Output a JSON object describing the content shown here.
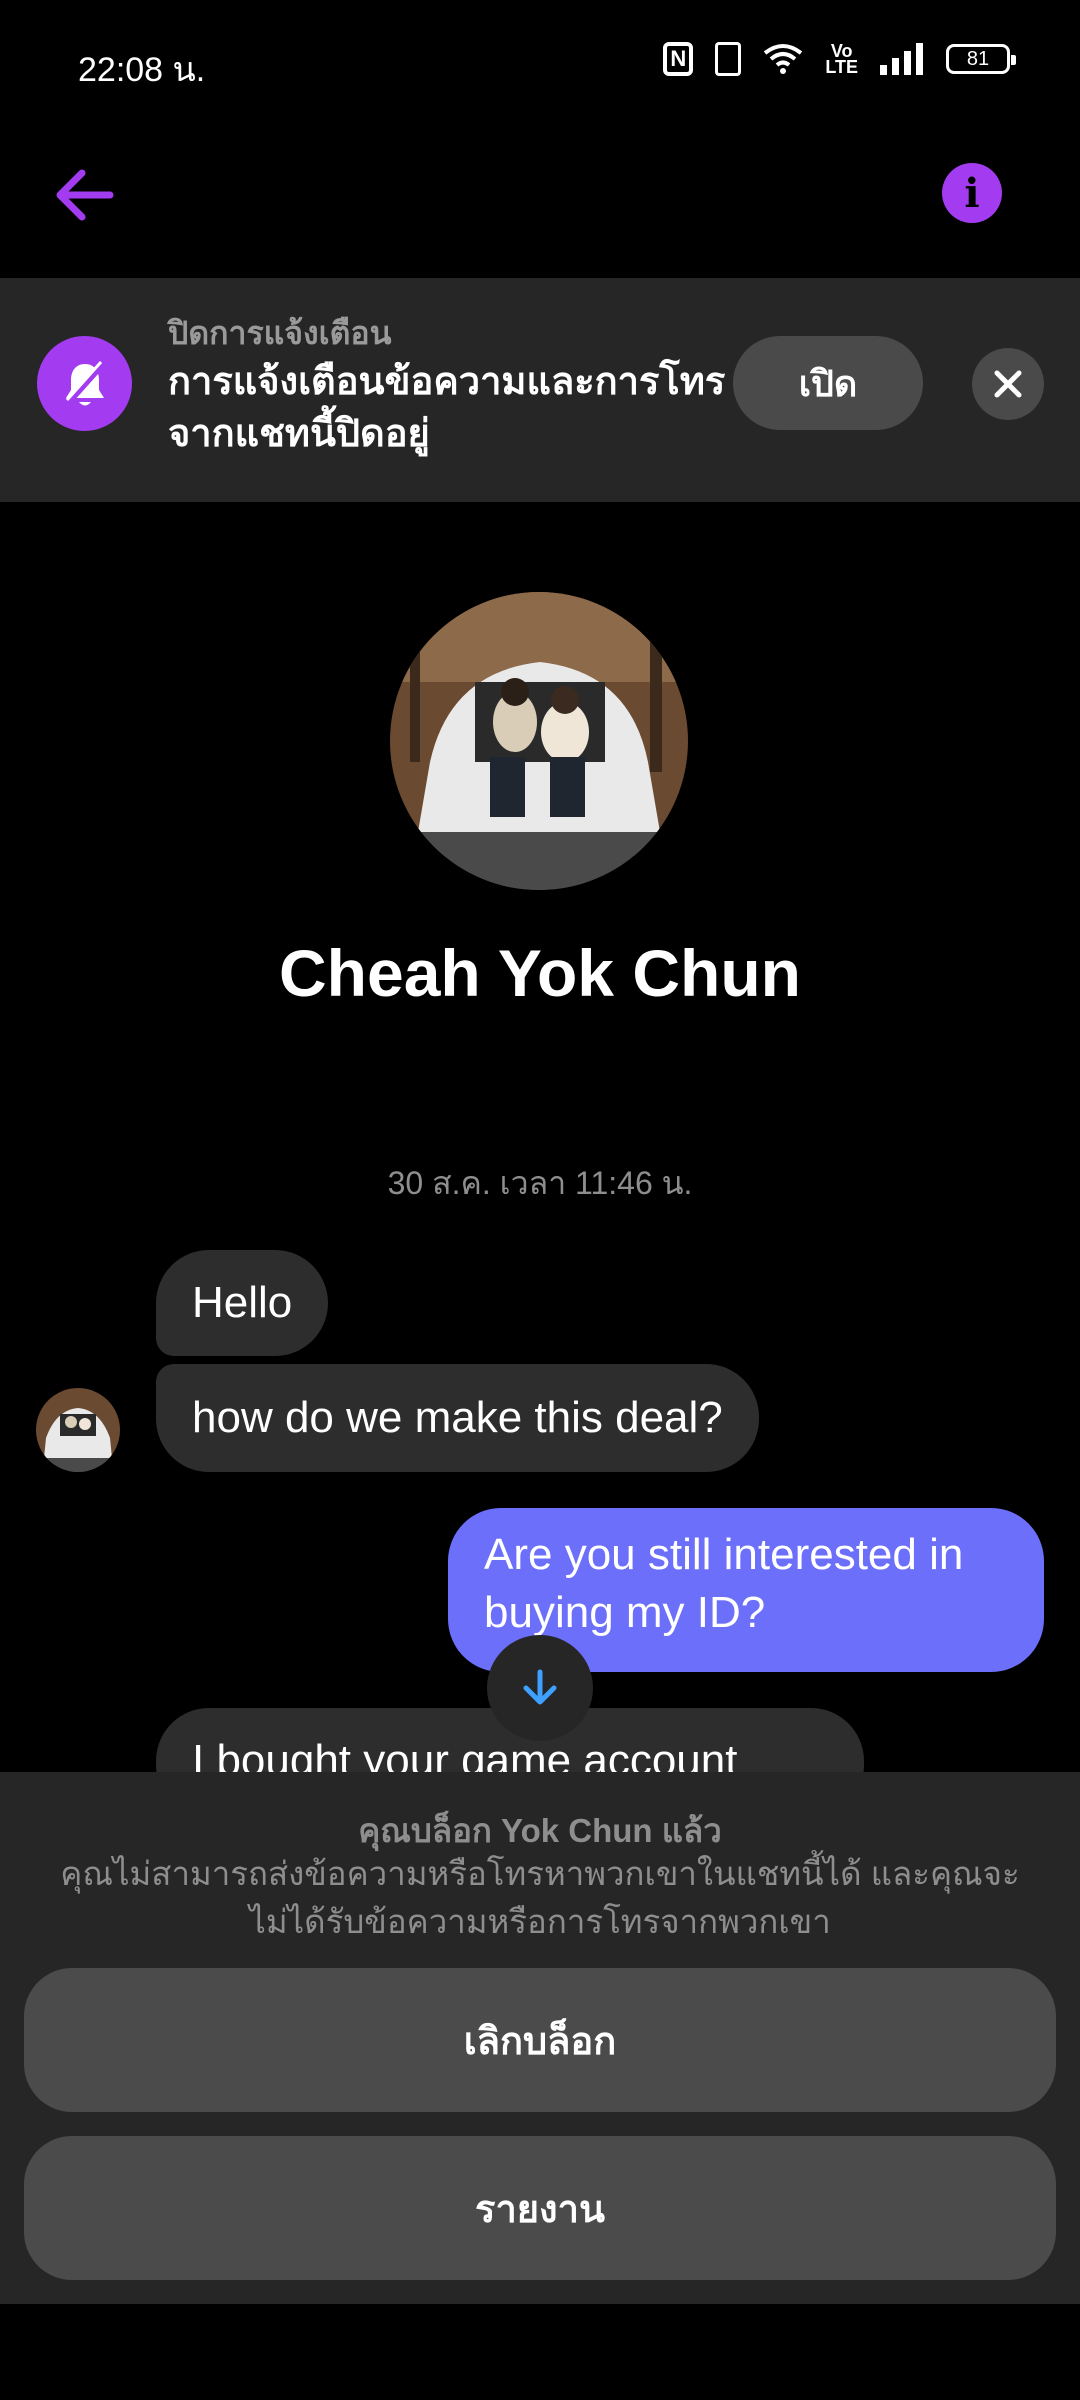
{
  "status_bar": {
    "time": "22:08 น.",
    "nfc": "N",
    "volte": "Vo\nLTE",
    "battery": "81"
  },
  "header": {
    "back_icon": "arrow-left-icon",
    "info_icon": "info-icon",
    "accent_color": "#a33cf0"
  },
  "mute_banner": {
    "icon": "bell-off-icon",
    "title": "ปิดการแจ้งเตือน",
    "message": "การแจ้งเตือนข้อความและการโทรจากแชทนี้ปิดอยู่",
    "turn_on_label": "เปิด",
    "close_icon": "close-icon"
  },
  "profile": {
    "name": "Cheah Yok Chun"
  },
  "chat": {
    "timestamp": "30 ส.ค. เวลา 11:46 น.",
    "messages": [
      {
        "direction": "incoming",
        "text": "Hello"
      },
      {
        "direction": "incoming",
        "text": "how do we make this deal?"
      },
      {
        "direction": "outgoing",
        "text": "Are you still interested in buying my ID?"
      },
      {
        "direction": "incoming",
        "text": "I bought your game account"
      }
    ],
    "outgoing_color": "#6b6ff9",
    "scroll_icon": "arrow-down-icon"
  },
  "blocked_sheet": {
    "title": "คุณบล็อก Yok Chun แล้ว",
    "description": "คุณไม่สามารถส่งข้อความหรือโทรหาพวกเขาในแชทนี้ได้ และคุณจะไม่ได้รับข้อความหรือการโทรจากพวกเขา",
    "unblock_label": "เลิกบล็อก",
    "report_label": "รายงาน"
  }
}
